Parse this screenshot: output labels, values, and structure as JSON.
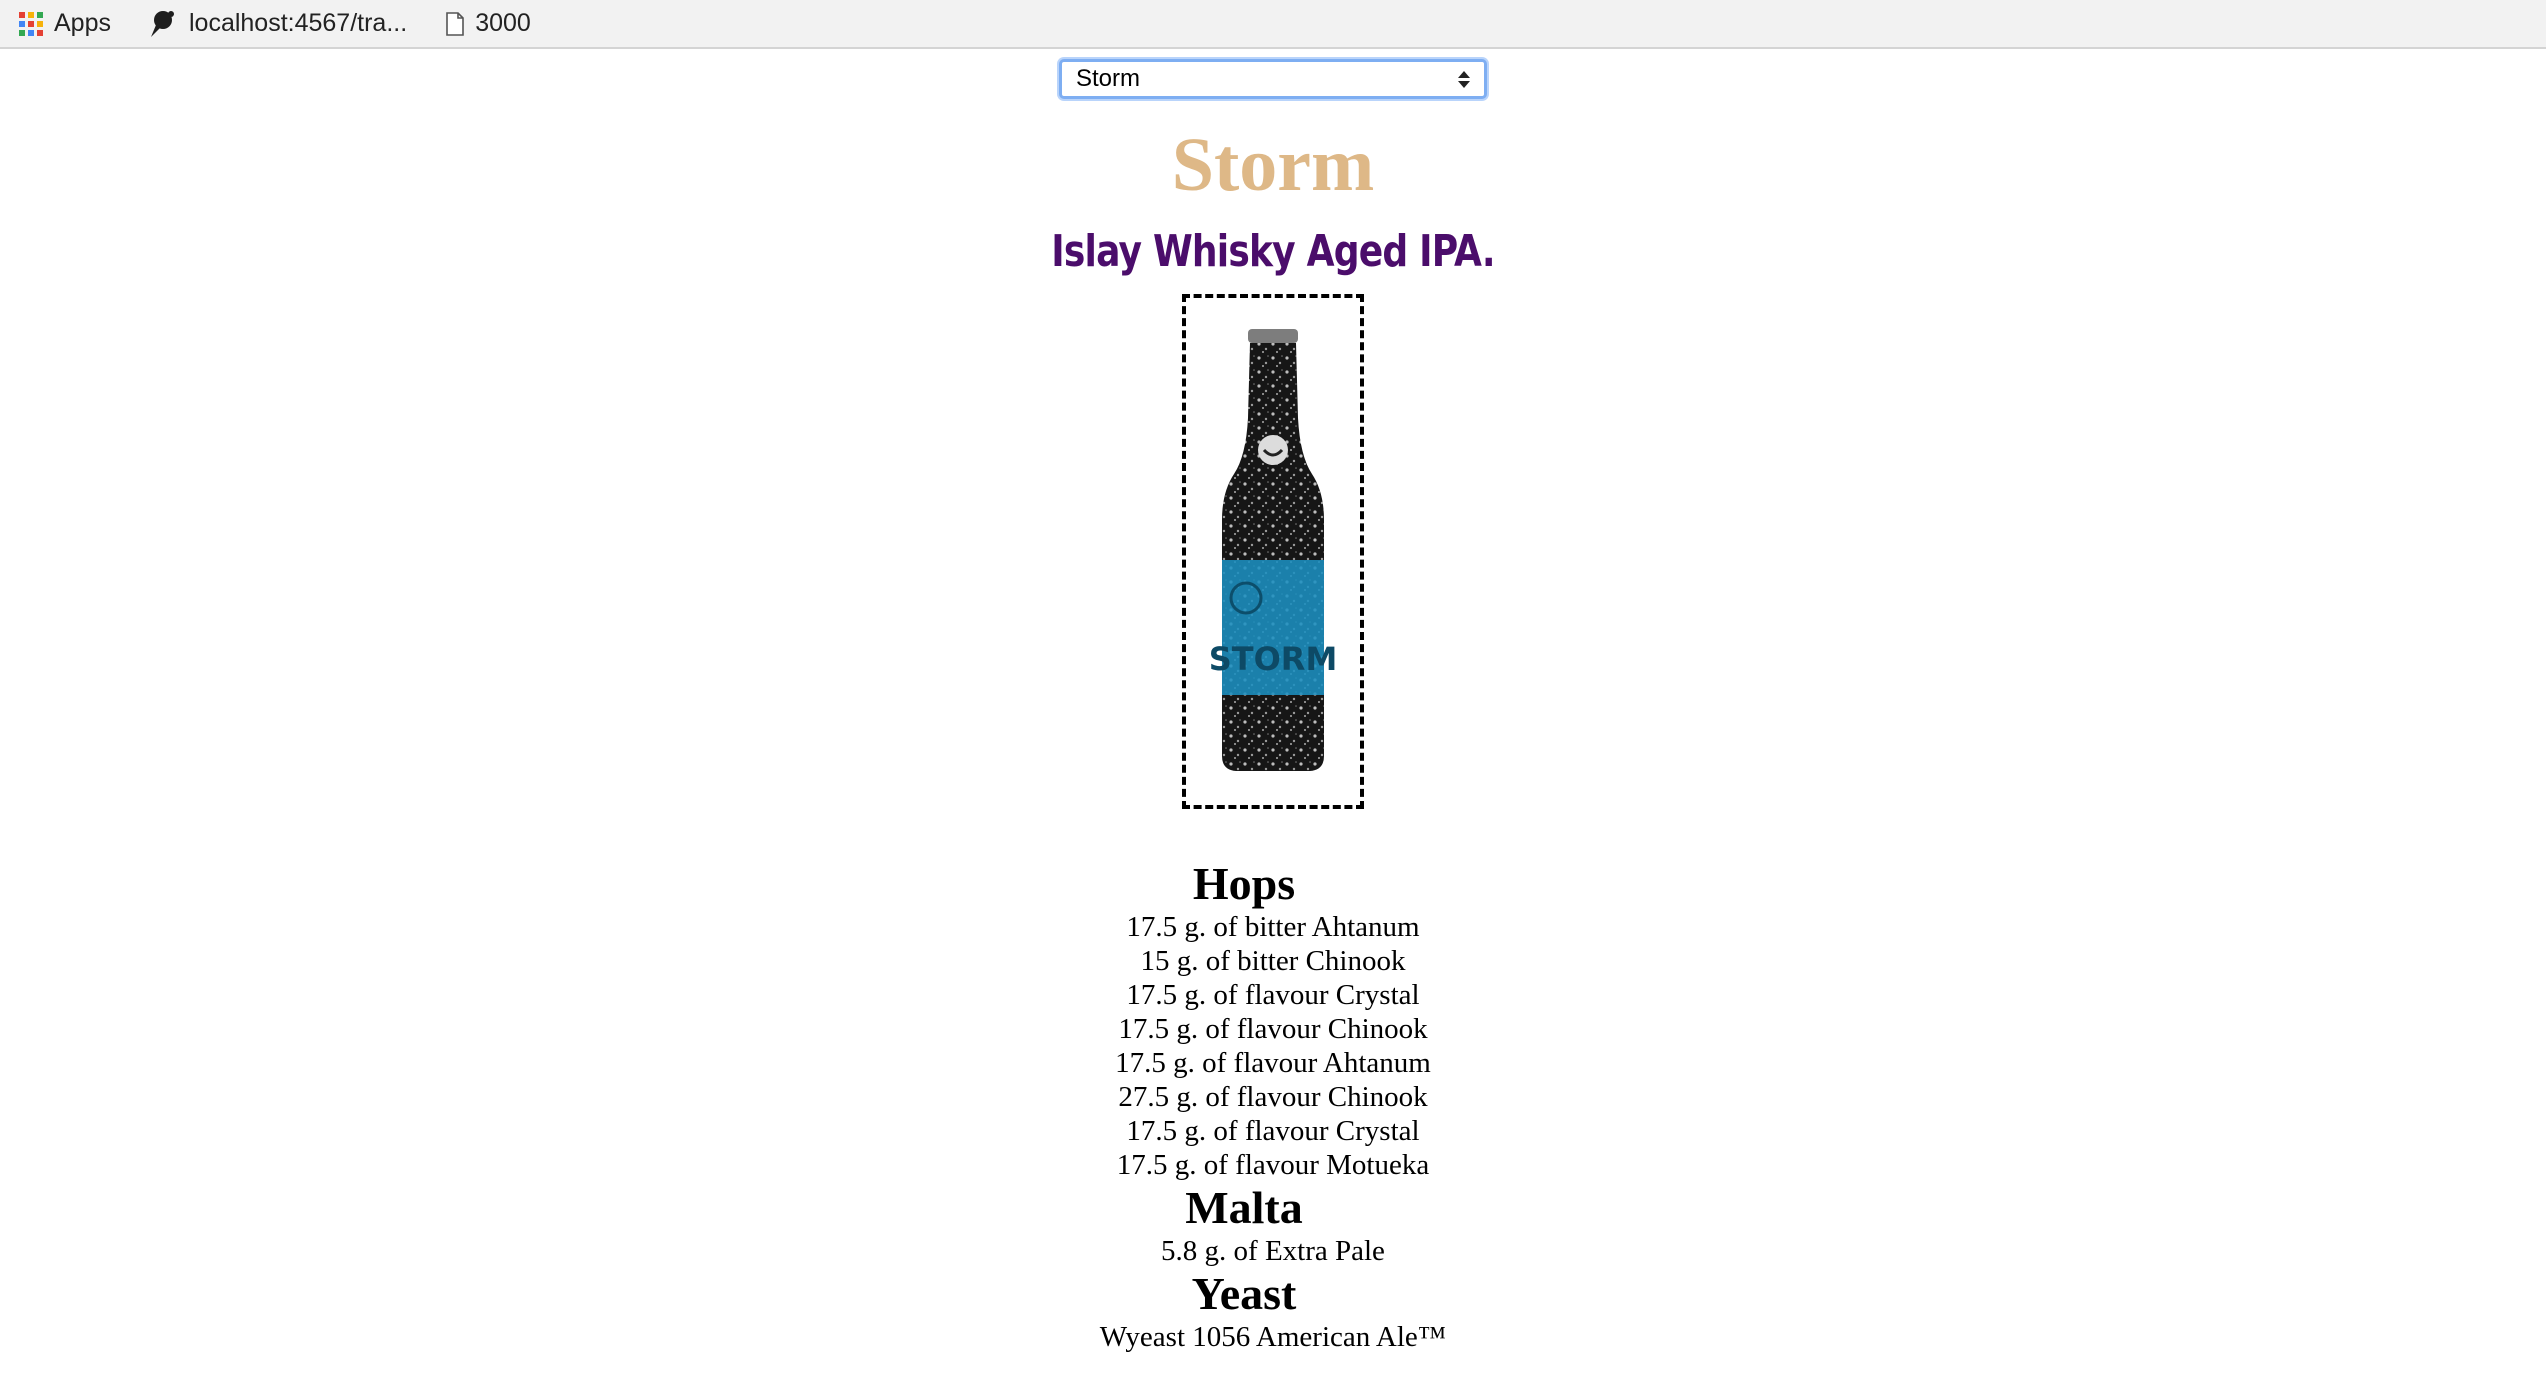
{
  "bookmarks": [
    {
      "icon": "apps-grid-icon",
      "label": "Apps"
    },
    {
      "icon": "pushpin-icon",
      "label": "localhost:4567/tra..."
    },
    {
      "icon": "page-icon",
      "label": "3000"
    }
  ],
  "selector": {
    "selected": "Storm"
  },
  "beer": {
    "name": "Storm",
    "tagline": "Islay Whisky Aged IPA.",
    "bottle_label_text": "STORM"
  },
  "colors": {
    "name": "#deb887",
    "tagline": "#4b0d6b",
    "label": "#1c8fc0"
  },
  "sections": {
    "hops": {
      "title": "Hops",
      "items": [
        "17.5 g. of bitter Ahtanum",
        "15 g. of bitter Chinook",
        "17.5 g. of flavour Crystal",
        "17.5 g. of flavour Chinook",
        "17.5 g. of flavour Ahtanum",
        "27.5 g. of flavour Chinook",
        "17.5 g. of flavour Crystal",
        "17.5 g. of flavour Motueka"
      ]
    },
    "malt": {
      "title": "Malta",
      "items": [
        "5.8 g. of Extra Pale"
      ]
    },
    "yeast": {
      "title": "Yeast",
      "items": [
        "Wyeast 1056 American Ale™"
      ]
    }
  }
}
